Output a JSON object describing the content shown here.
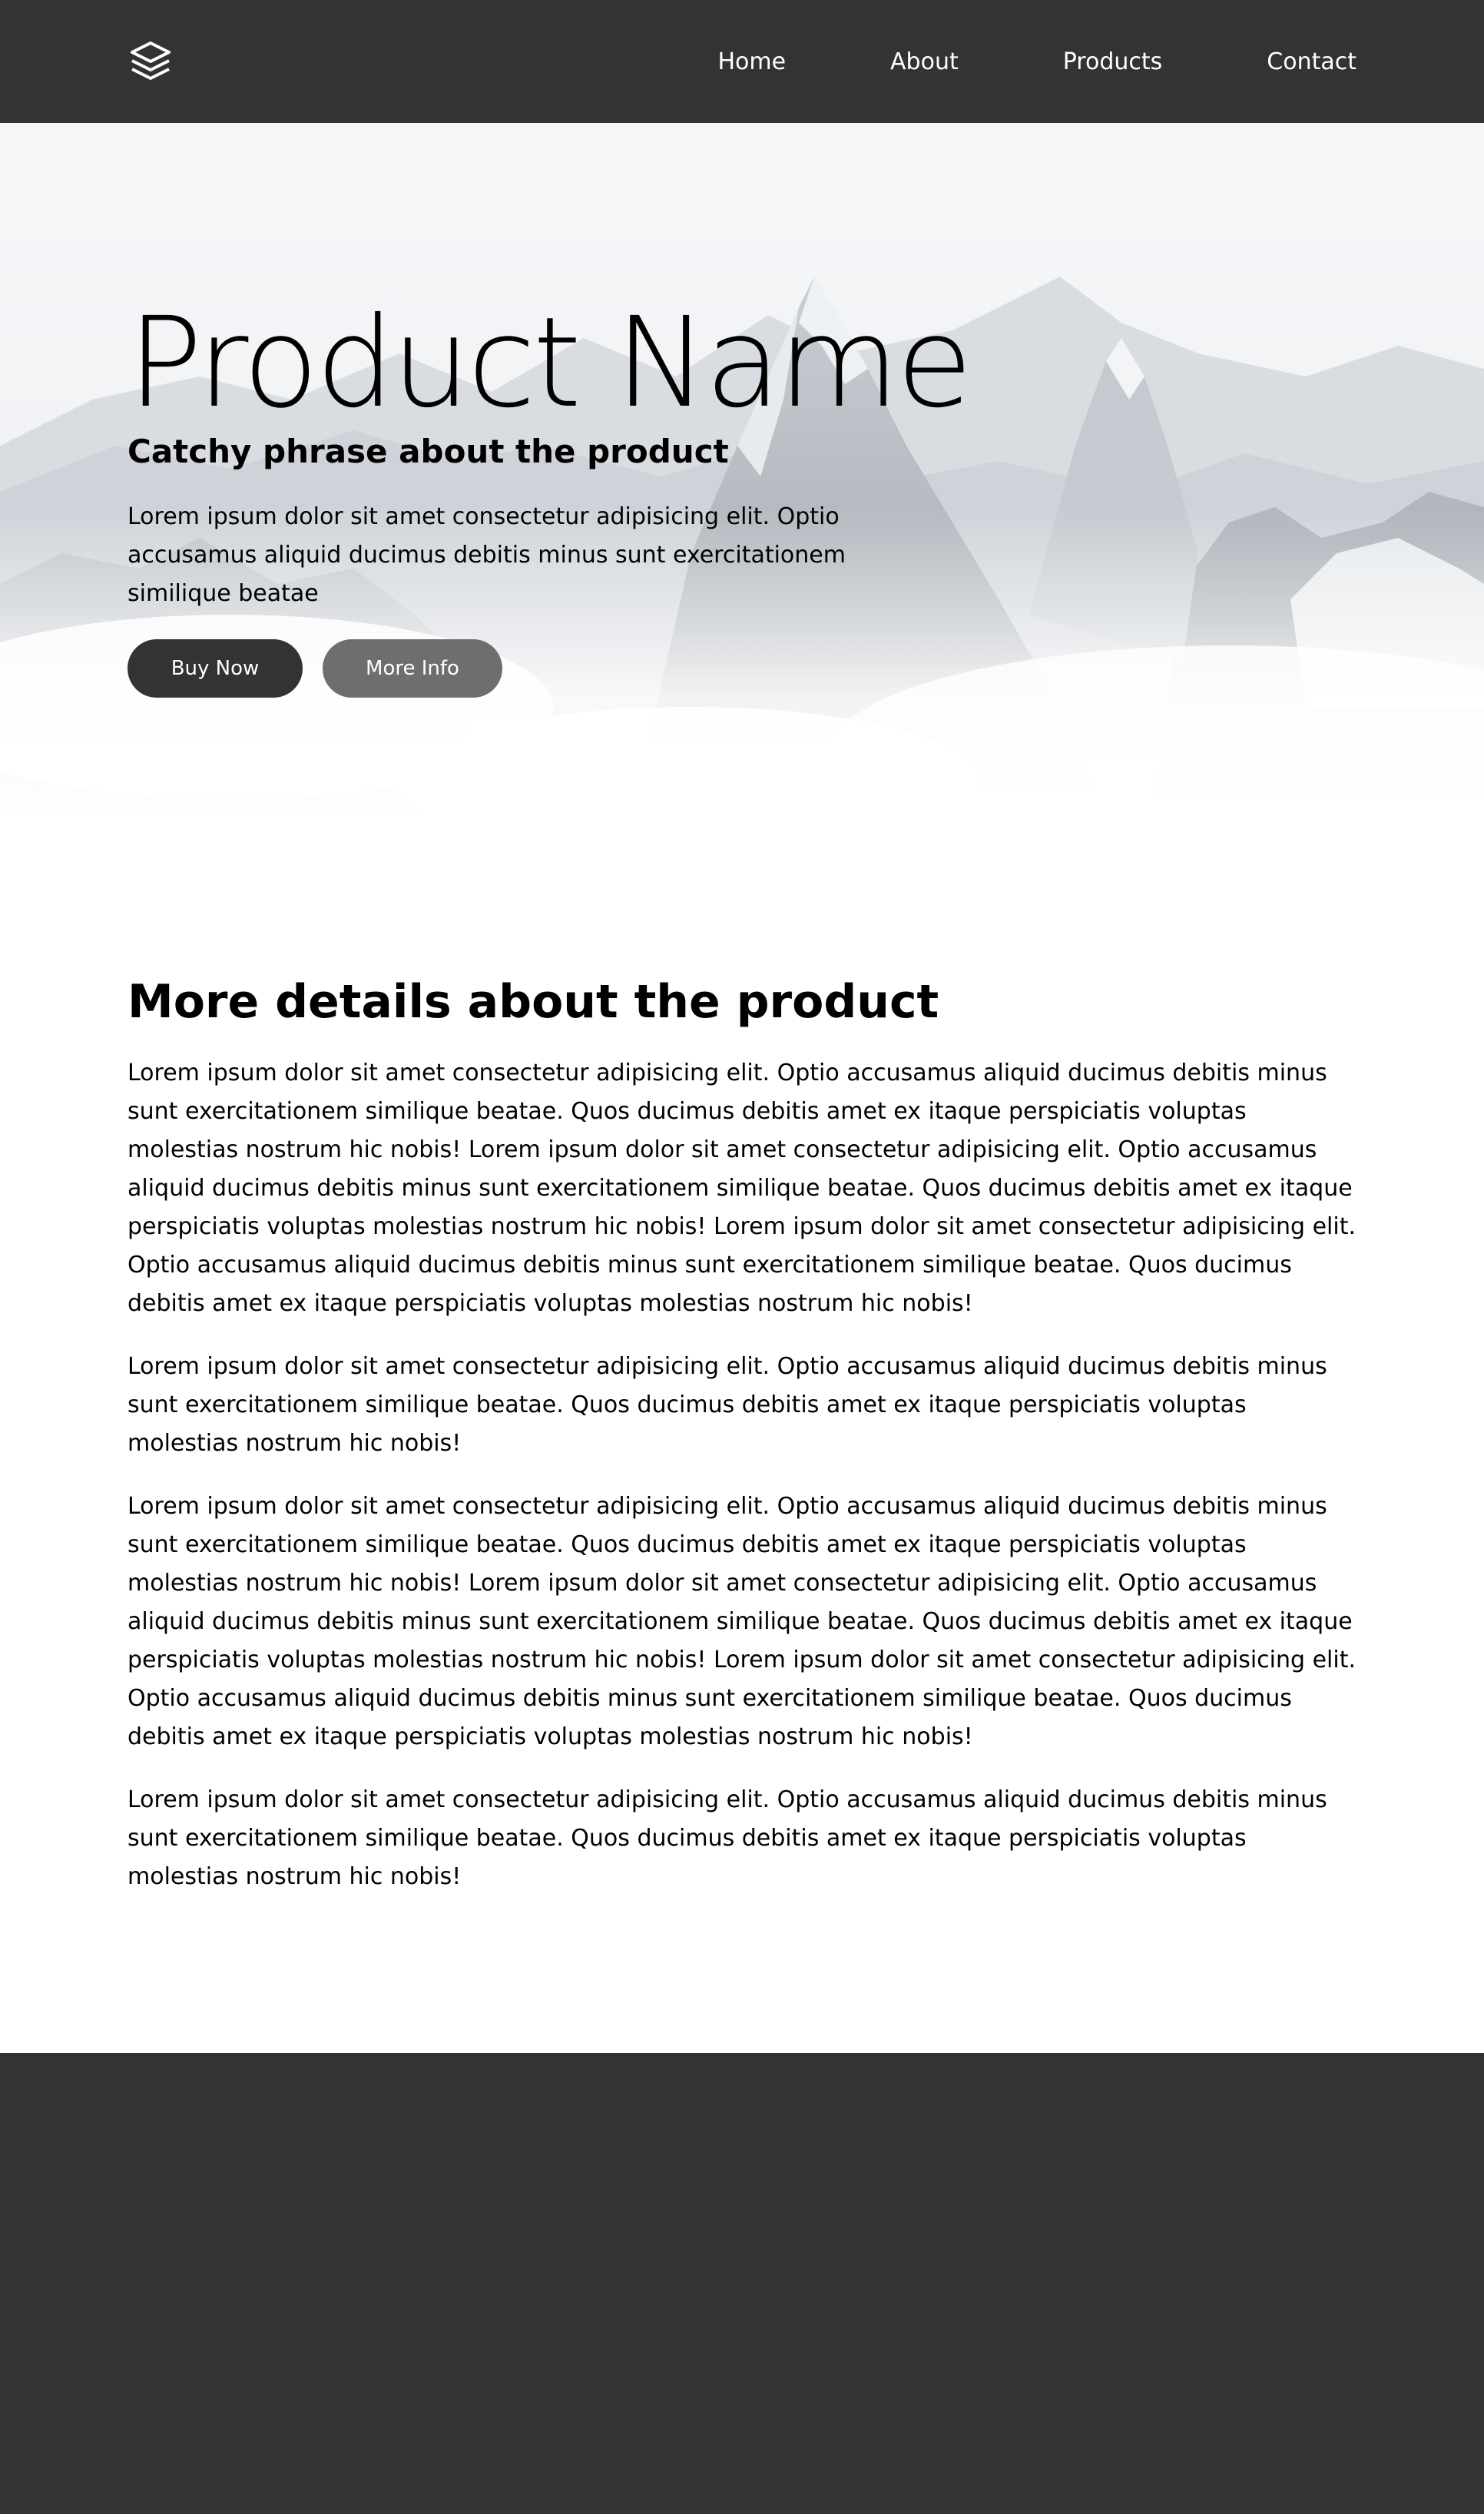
{
  "nav": {
    "logo_icon": "layers-icon",
    "links": [
      "Home",
      "About",
      "Products",
      "Contact"
    ]
  },
  "hero": {
    "title": "Product Name",
    "subtitle": "Catchy phrase about the product",
    "description": "Lorem ipsum dolor sit amet consectetur adipisicing elit. Optio accusamus aliquid ducimus debitis minus sunt exercitationem similique beatae",
    "buy_label": "Buy Now",
    "info_label": "More Info",
    "background": "mountain-landscape-image"
  },
  "details": {
    "title": "More details about the product",
    "paragraphs": [
      "Lorem ipsum dolor sit amet consectetur adipisicing elit. Optio accusamus aliquid ducimus debitis minus sunt exercitationem similique beatae. Quos ducimus debitis amet ex itaque perspiciatis voluptas molestias nostrum hic nobis! Lorem ipsum dolor sit amet consectetur adipisicing elit. Optio accusamus aliquid ducimus debitis minus sunt exercitationem similique beatae. Quos ducimus debitis amet ex itaque perspiciatis voluptas molestias nostrum hic nobis! Lorem ipsum dolor sit amet consectetur adipisicing elit. Optio accusamus aliquid ducimus debitis minus sunt exercitationem similique beatae. Quos ducimus debitis amet ex itaque perspiciatis voluptas molestias nostrum hic nobis!",
      "Lorem ipsum dolor sit amet consectetur adipisicing elit. Optio accusamus aliquid ducimus debitis minus sunt exercitationem similique beatae. Quos ducimus debitis amet ex itaque perspiciatis voluptas molestias nostrum hic nobis!",
      "Lorem ipsum dolor sit amet consectetur adipisicing elit. Optio accusamus aliquid ducimus debitis minus sunt exercitationem similique beatae. Quos ducimus debitis amet ex itaque perspiciatis voluptas molestias nostrum hic nobis! Lorem ipsum dolor sit amet consectetur adipisicing elit. Optio accusamus aliquid ducimus debitis minus sunt exercitationem similique beatae. Quos ducimus debitis amet ex itaque perspiciatis voluptas molestias nostrum hic nobis! Lorem ipsum dolor sit amet consectetur adipisicing elit. Optio accusamus aliquid ducimus debitis minus sunt exercitationem similique beatae. Quos ducimus debitis amet ex itaque perspiciatis voluptas molestias nostrum hic nobis!",
      "Lorem ipsum dolor sit amet consectetur adipisicing elit. Optio accusamus aliquid ducimus debitis minus sunt exercitationem similique beatae. Quos ducimus debitis amet ex itaque perspiciatis voluptas molestias nostrum hic nobis!"
    ]
  },
  "colors": {
    "nav_bg": "#333333",
    "footer_bg": "#333333",
    "primary_button": "#333333",
    "secondary_button": "#6e6e6e"
  }
}
